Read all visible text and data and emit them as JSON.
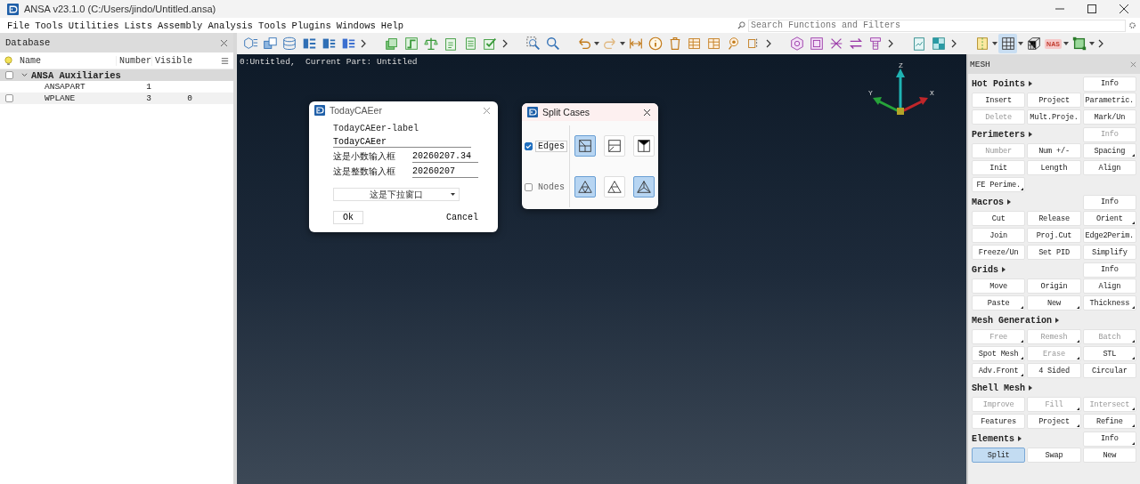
{
  "window": {
    "title": "ANSA v23.1.0 (C:/Users/jindo/Untitled.ansa)"
  },
  "menu": [
    "File",
    "Tools",
    "Utilities",
    "Lists",
    "Assembly",
    "Analysis Tools",
    "Plugins",
    "Windows",
    "Help"
  ],
  "search": {
    "placeholder": "Search Functions and Filters"
  },
  "toolbar": {
    "badge": "NAS"
  },
  "database": {
    "title": "Database",
    "columns": [
      "Name",
      "Number",
      "Visible"
    ],
    "rows": [
      {
        "name": "ANSA Auxiliaries",
        "kind": "checkable",
        "checked": false,
        "expanded": true,
        "selected": true,
        "children": [
          {
            "name": "ANSAPART",
            "number": "1",
            "kind": "plain",
            "selected": false
          },
          {
            "name": "WPLANE",
            "number": "3",
            "visible": "0",
            "kind": "checkable",
            "checked": false,
            "selected": false
          }
        ]
      }
    ]
  },
  "viewport": {
    "info": "0:Untitled,  Current Part: Untitled",
    "axes": {
      "z": "Z",
      "y": "Y",
      "x": "X"
    }
  },
  "today_dialog": {
    "title": "TodayCAEer",
    "label": "TodayCAEer-label",
    "text_value": "TodayCAEer",
    "fields": [
      {
        "label": "这是小数输入框",
        "value": "20260207.34"
      },
      {
        "label": "这是整数输入框",
        "value": "20260207"
      }
    ],
    "dropdown": "这是下拉窗口",
    "ok": "Ok",
    "cancel": "Cancel"
  },
  "split_dialog": {
    "title": "Split Cases",
    "options": [
      {
        "label": "Edges",
        "checked": true
      },
      {
        "label": "Nodes",
        "checked": false
      }
    ],
    "cases": [
      [
        {
          "selected": true
        },
        {
          "selected": false
        },
        {
          "selected": false
        }
      ],
      [
        {
          "selected": true
        },
        {
          "selected": false
        },
        {
          "selected": true
        }
      ]
    ]
  },
  "mesh_panel": {
    "title": "MESH",
    "sections": [
      {
        "title": "Hot Points",
        "info": {
          "label": "Info",
          "disabled": false,
          "menu": false
        },
        "buttons": [
          {
            "label": "Insert",
            "disabled": false,
            "menu": false,
            "selected": false
          },
          {
            "label": "Project",
            "disabled": false,
            "menu": false,
            "selected": false
          },
          {
            "label": "Parametric.",
            "disabled": false,
            "menu": false,
            "selected": false
          },
          {
            "label": "Delete",
            "disabled": true,
            "menu": false,
            "selected": false
          },
          {
            "label": "Mult.Proje.",
            "disabled": false,
            "menu": false,
            "selected": false
          },
          {
            "label": "Mark/Un",
            "disabled": false,
            "menu": false,
            "selected": false
          }
        ]
      },
      {
        "title": "Perimeters",
        "info": {
          "label": "Info",
          "disabled": true,
          "menu": false
        },
        "buttons": [
          {
            "label": "Number",
            "disabled": true,
            "menu": false,
            "selected": false
          },
          {
            "label": "Num +/-",
            "disabled": false,
            "menu": false,
            "selected": false
          },
          {
            "label": "Spacing",
            "disabled": false,
            "menu": true,
            "selected": false
          },
          {
            "label": "Init",
            "disabled": false,
            "menu": false,
            "selected": false
          },
          {
            "label": "Length",
            "disabled": false,
            "menu": false,
            "selected": false
          },
          {
            "label": "Align",
            "disabled": false,
            "menu": false,
            "selected": false
          },
          {
            "label": "FE Perime.",
            "disabled": false,
            "menu": true,
            "selected": false
          }
        ]
      },
      {
        "title": "Macros",
        "info": {
          "label": "Info",
          "disabled": false,
          "menu": false
        },
        "buttons": [
          {
            "label": "Cut",
            "disabled": false,
            "menu": false,
            "selected": false
          },
          {
            "label": "Release",
            "disabled": false,
            "menu": false,
            "selected": false
          },
          {
            "label": "Orient",
            "disabled": false,
            "menu": true,
            "selected": false
          },
          {
            "label": "Join",
            "disabled": false,
            "menu": false,
            "selected": false
          },
          {
            "label": "Proj.Cut",
            "disabled": false,
            "menu": false,
            "selected": false
          },
          {
            "label": "Edge2Perim.",
            "disabled": false,
            "menu": false,
            "selected": false
          },
          {
            "label": "Freeze/Un",
            "disabled": false,
            "menu": false,
            "selected": false
          },
          {
            "label": "Set PID",
            "disabled": false,
            "menu": false,
            "selected": false
          },
          {
            "label": "Simplify",
            "disabled": false,
            "menu": false,
            "selected": false
          }
        ]
      },
      {
        "title": "Grids",
        "info": {
          "label": "Info",
          "disabled": false,
          "menu": false
        },
        "buttons": [
          {
            "label": "Move",
            "disabled": false,
            "menu": false,
            "selected": false
          },
          {
            "label": "Origin",
            "disabled": false,
            "menu": false,
            "selected": false
          },
          {
            "label": "Align",
            "disabled": false,
            "menu": false,
            "selected": false
          },
          {
            "label": "Paste",
            "disabled": false,
            "menu": true,
            "selected": false
          },
          {
            "label": "New",
            "disabled": false,
            "menu": true,
            "selected": false
          },
          {
            "label": "Thickness",
            "disabled": false,
            "menu": true,
            "selected": false
          }
        ]
      },
      {
        "title": "Mesh Generation",
        "buttons": [
          {
            "label": "Free",
            "disabled": true,
            "menu": true,
            "selected": false
          },
          {
            "label": "Remesh",
            "disabled": true,
            "menu": true,
            "selected": false
          },
          {
            "label": "Batch",
            "disabled": true,
            "menu": true,
            "selected": false
          },
          {
            "label": "Spot Mesh",
            "disabled": false,
            "menu": true,
            "selected": false
          },
          {
            "label": "Erase",
            "disabled": true,
            "menu": true,
            "selected": false
          },
          {
            "label": "STL",
            "disabled": false,
            "menu": true,
            "selected": false
          },
          {
            "label": "Adv.Front",
            "disabled": false,
            "menu": true,
            "selected": false
          },
          {
            "label": "4 Sided",
            "disabled": false,
            "menu": false,
            "selected": false
          },
          {
            "label": "Circular",
            "disabled": false,
            "menu": false,
            "selected": false
          }
        ]
      },
      {
        "title": "Shell Mesh",
        "buttons": [
          {
            "label": "Improve",
            "disabled": true,
            "menu": false,
            "selected": false
          },
          {
            "label": "Fill",
            "disabled": true,
            "menu": true,
            "selected": false
          },
          {
            "label": "Intersect",
            "disabled": true,
            "menu": true,
            "selected": false
          },
          {
            "label": "Features",
            "disabled": false,
            "menu": false,
            "selected": false
          },
          {
            "label": "Project",
            "disabled": false,
            "menu": true,
            "selected": false
          },
          {
            "label": "Refine",
            "disabled": false,
            "menu": true,
            "selected": false
          }
        ]
      },
      {
        "title": "Elements",
        "info": {
          "label": "Info",
          "disabled": false,
          "menu": true
        },
        "buttons": [
          {
            "label": "Split",
            "disabled": false,
            "menu": false,
            "selected": true
          },
          {
            "label": "Swap",
            "disabled": false,
            "menu": false,
            "selected": false
          },
          {
            "label": "New",
            "disabled": false,
            "menu": false,
            "selected": false
          }
        ]
      }
    ]
  }
}
